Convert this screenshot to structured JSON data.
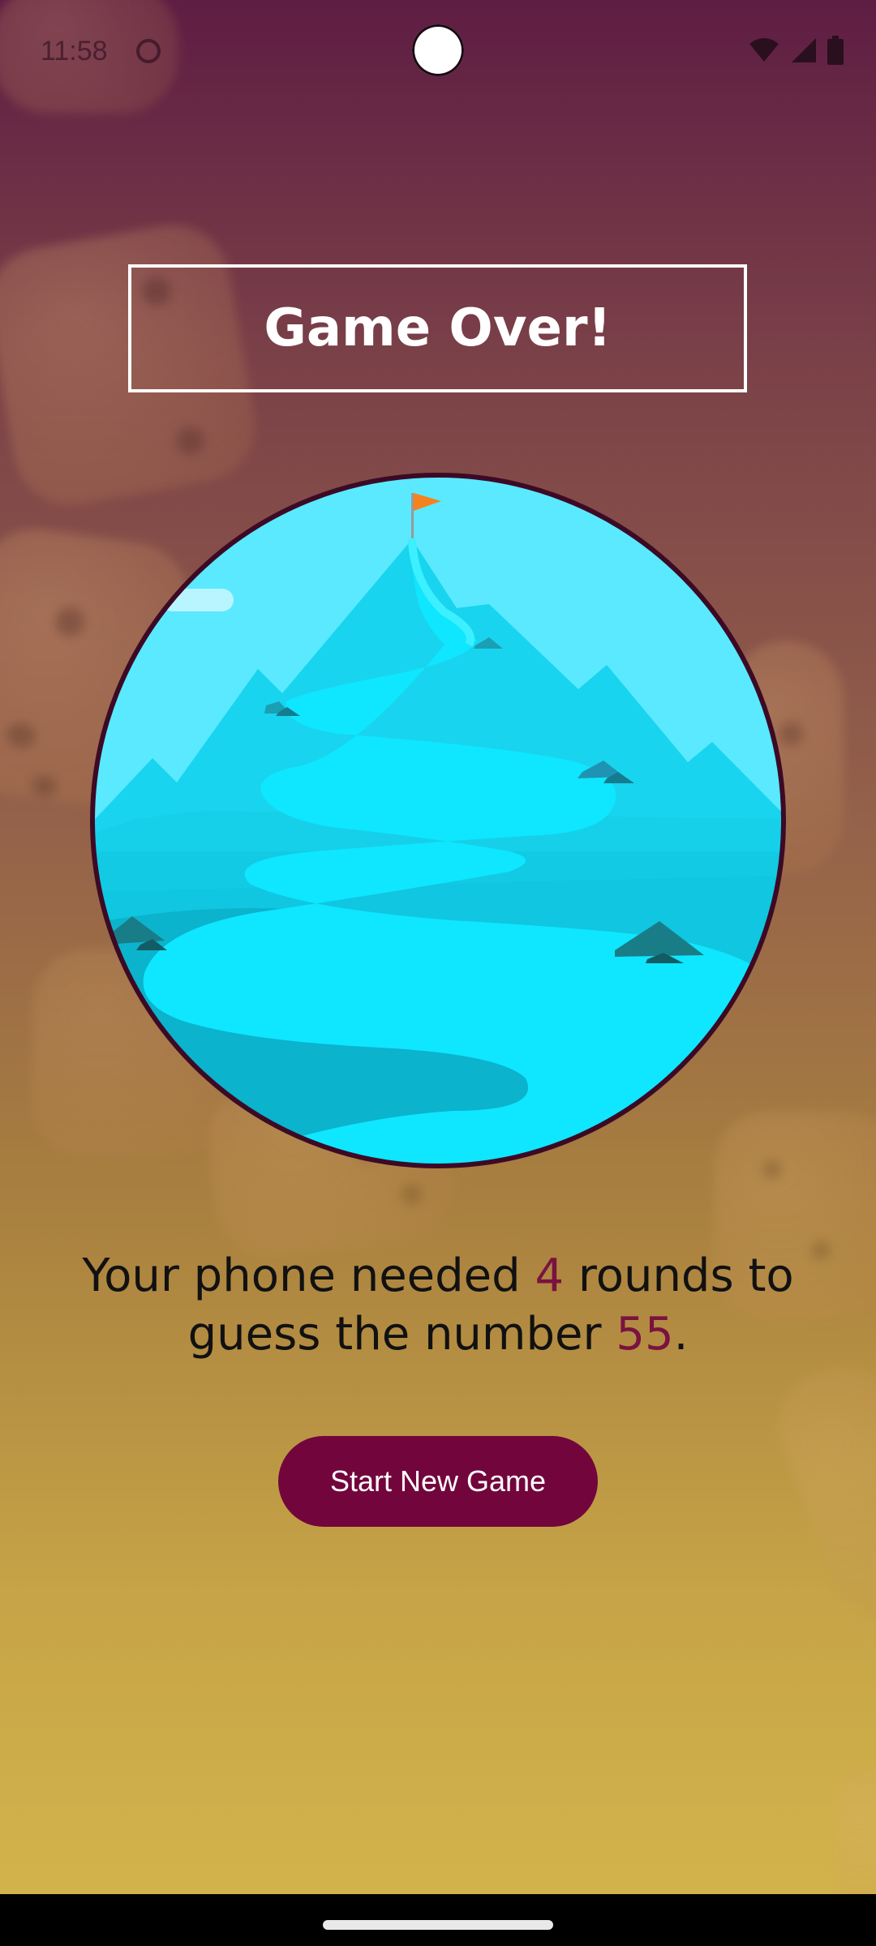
{
  "status_bar": {
    "time": "11:58",
    "icons": [
      "app-notification-icon",
      "wifi-icon",
      "cell-signal-icon",
      "battery-icon"
    ]
  },
  "game_over": {
    "title": "Game Over!"
  },
  "illustration": {
    "icon": "mountain-summit-flag-icon"
  },
  "summary": {
    "prefix": "Your phone needed ",
    "rounds": "4",
    "middle": " rounds to guess the number ",
    "number": "55",
    "suffix": "."
  },
  "actions": {
    "start_new_game": "Start New Game"
  },
  "colors": {
    "accent": "#72063c",
    "highlight": "#7a1240",
    "sky": "#5ae9ff",
    "water": "#0fe6ff",
    "frame": "#3d0a25"
  }
}
